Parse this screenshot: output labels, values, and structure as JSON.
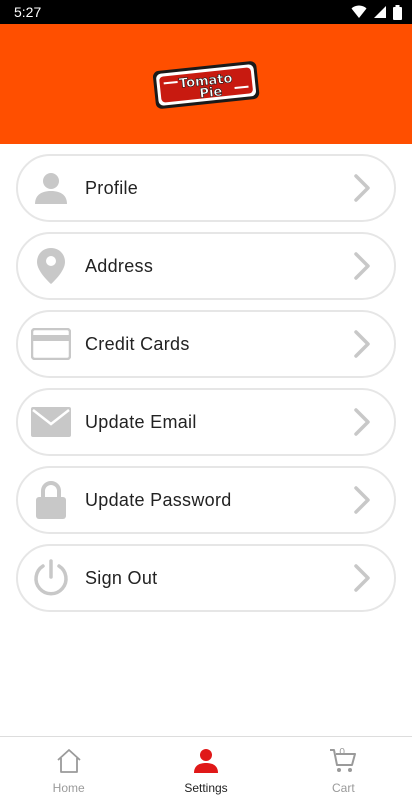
{
  "status_bar": {
    "time": "5:27"
  },
  "header": {
    "logo_alt": "Tomato Pie",
    "logo_line1": "Tomato",
    "logo_line2": "Pie"
  },
  "colors": {
    "brand": "#ff4f00",
    "active": "#e01818",
    "icon_gray": "#c8c8c8"
  },
  "menu": {
    "items": [
      {
        "label": "Profile",
        "icon": "person-icon"
      },
      {
        "label": "Address",
        "icon": "location-pin-icon"
      },
      {
        "label": "Credit Cards",
        "icon": "credit-card-icon"
      },
      {
        "label": "Update Email",
        "icon": "envelope-icon"
      },
      {
        "label": "Update Password",
        "icon": "lock-icon"
      },
      {
        "label": "Sign Out",
        "icon": "power-icon"
      }
    ]
  },
  "bottom_nav": {
    "items": [
      {
        "label": "Home",
        "icon": "home-icon",
        "active": false
      },
      {
        "label": "Settings",
        "icon": "person-icon",
        "active": true
      },
      {
        "label": "Cart",
        "icon": "cart-icon",
        "active": false,
        "count": "0"
      }
    ]
  }
}
